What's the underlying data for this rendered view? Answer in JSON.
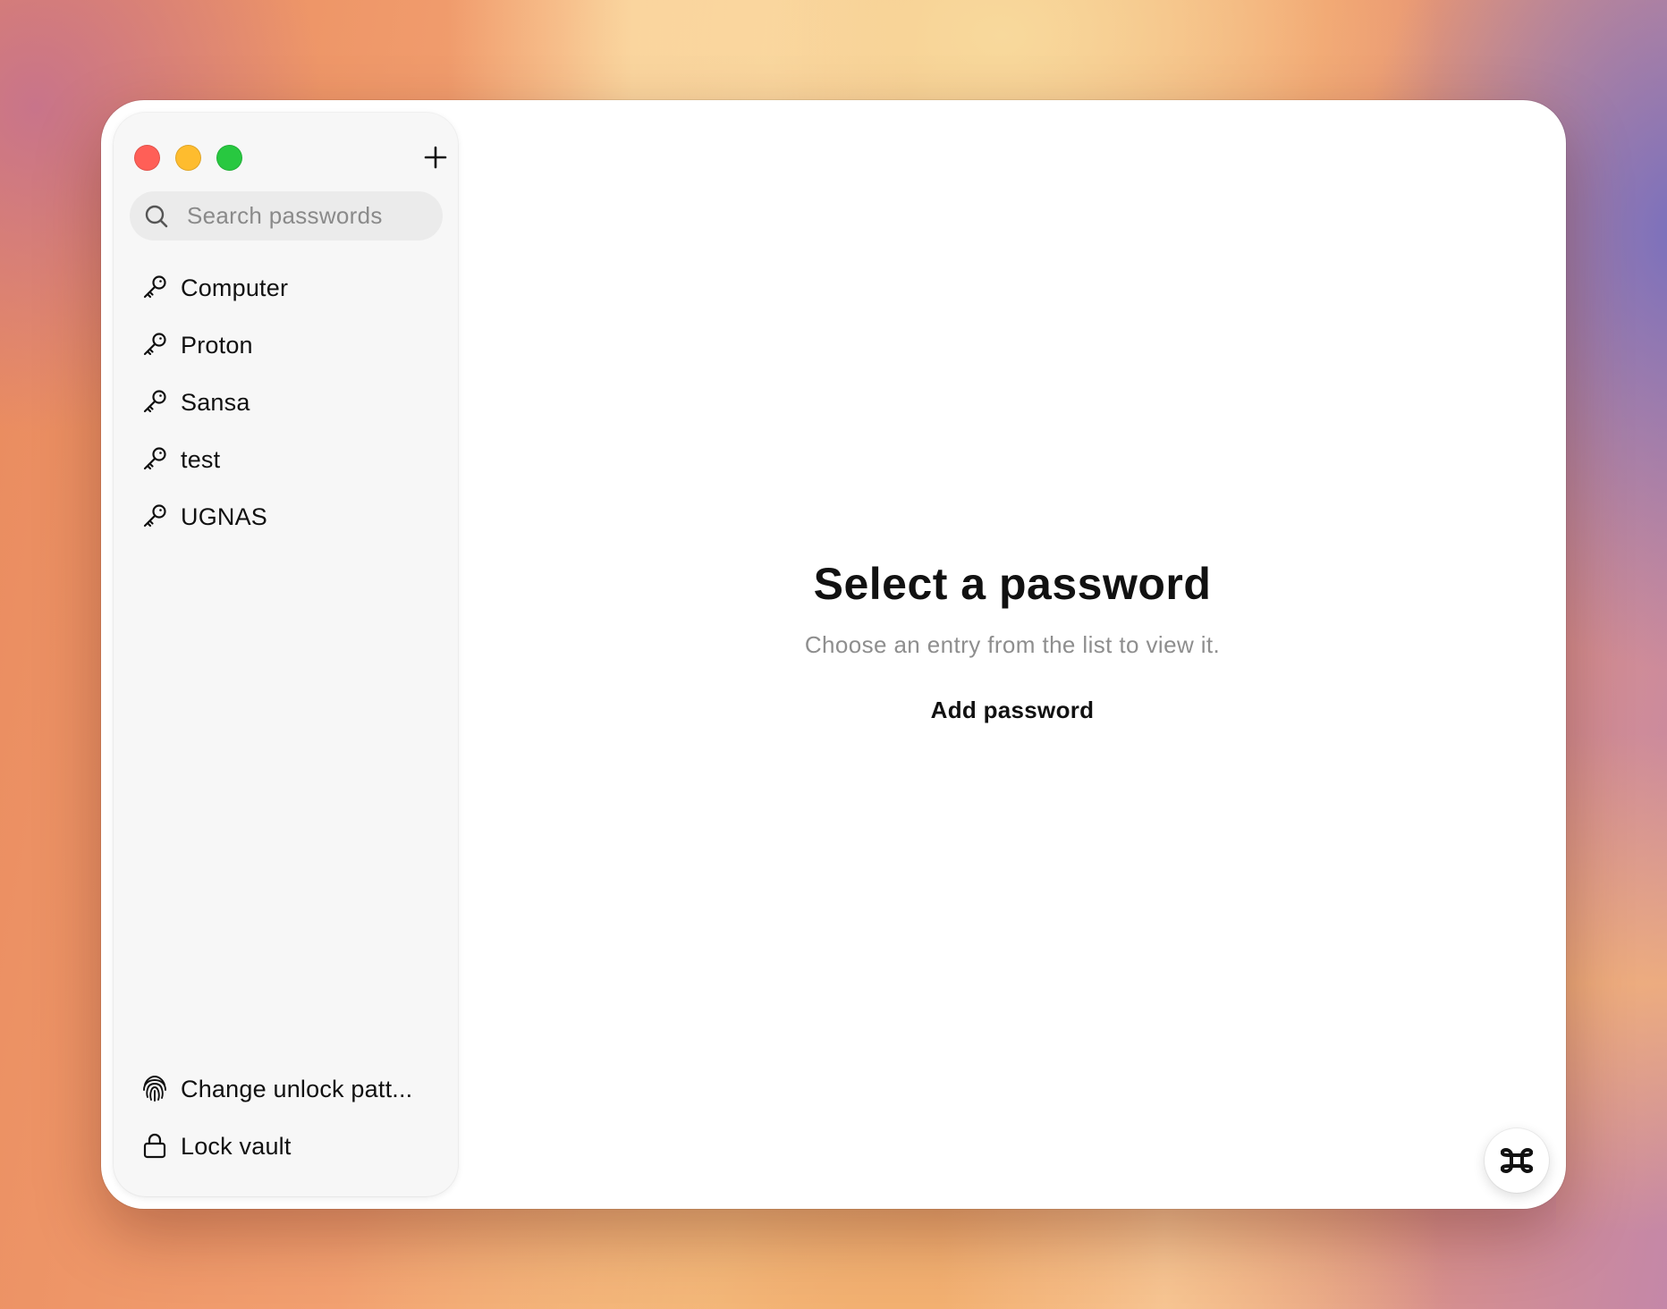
{
  "sidebar": {
    "add_button_icon": "plus-icon",
    "search": {
      "placeholder": "Search passwords",
      "value": "",
      "icon": "search-icon"
    },
    "entries": [
      {
        "label": "Computer",
        "icon": "key-icon"
      },
      {
        "label": "Proton",
        "icon": "key-icon"
      },
      {
        "label": "Sansa",
        "icon": "key-icon"
      },
      {
        "label": "test",
        "icon": "key-icon"
      },
      {
        "label": "UGNAS",
        "icon": "key-icon"
      }
    ],
    "bottom": {
      "change_pattern": {
        "label": "Change unlock patt...",
        "icon": "fingerprint-icon"
      },
      "lock_vault": {
        "label": "Lock vault",
        "icon": "lock-icon"
      }
    }
  },
  "window_controls": {
    "close_color": "#ff5f57",
    "minimize_color": "#febc2e",
    "zoom_color": "#28c840"
  },
  "main": {
    "empty_state": {
      "title": "Select a password",
      "subtitle": "Choose an entry from the list to view it.",
      "action_label": "Add password"
    }
  },
  "corner_button": {
    "icon": "command-key-icon"
  }
}
